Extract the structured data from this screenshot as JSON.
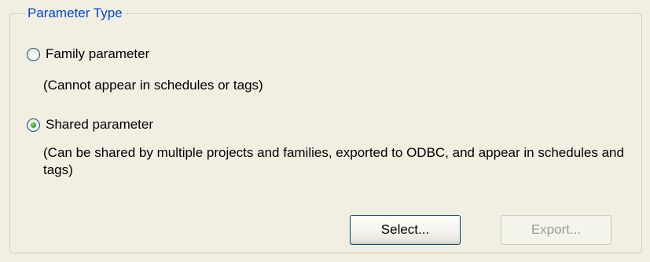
{
  "group": {
    "title": "Parameter Type"
  },
  "options": {
    "family": {
      "label": "Family parameter",
      "description": "(Cannot appear in schedules or tags)",
      "selected": false
    },
    "shared": {
      "label": "Shared parameter",
      "description": "(Can be shared by multiple projects and families, exported to ODBC, and appear in schedules and tags)",
      "selected": true
    }
  },
  "buttons": {
    "select_label": "Select...",
    "export_label": "Export...",
    "export_enabled": false
  },
  "colors": {
    "background": "#f1efe2",
    "group_title": "#0046d5",
    "radio_dot": "#2fa82f",
    "disabled_text": "#a19f92"
  }
}
